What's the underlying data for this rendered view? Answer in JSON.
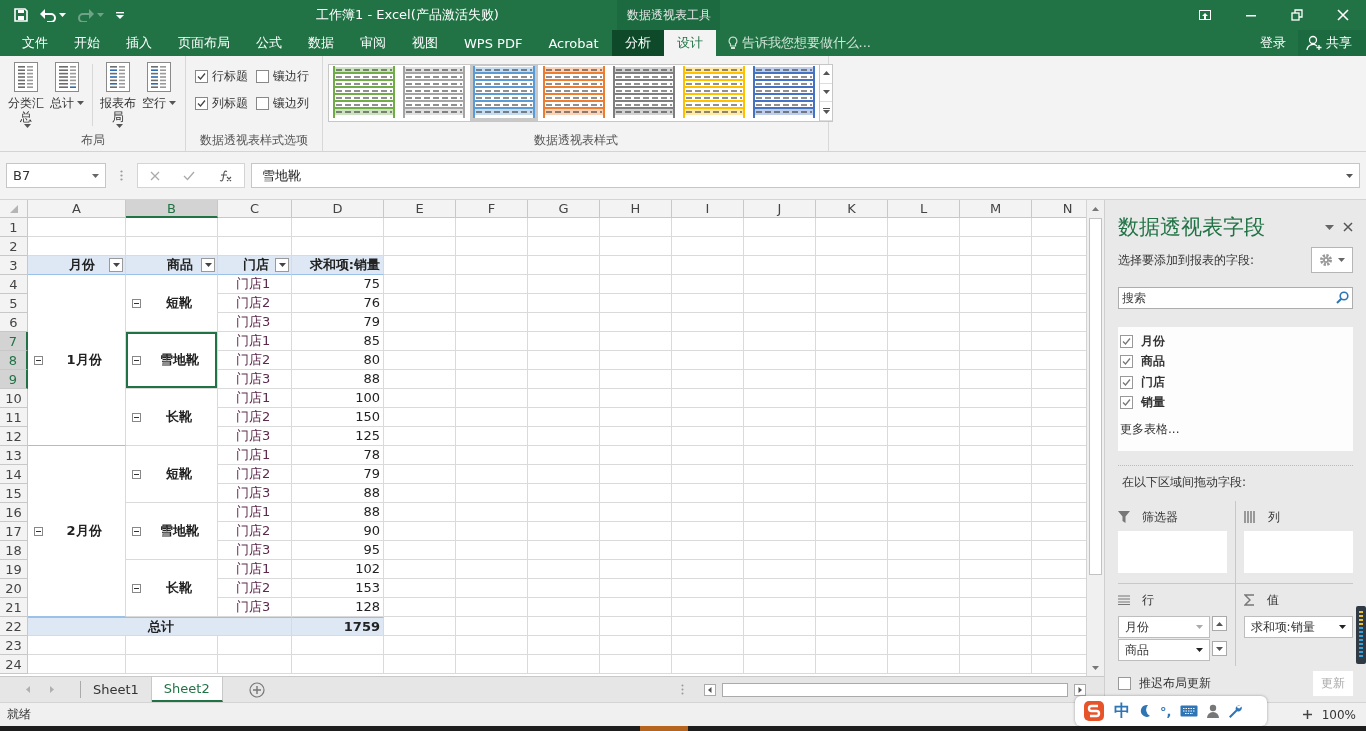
{
  "window": {
    "title": "工作簿1 - Excel(产品激活失败)",
    "context_group": "数据透视表工具",
    "sign_in": "登录",
    "share": "共享"
  },
  "quick_access": [
    {
      "kind": "save",
      "disabled": false
    },
    {
      "kind": "undo",
      "disabled": false
    },
    {
      "kind": "redo",
      "disabled": true
    },
    {
      "kind": "customize",
      "disabled": false
    }
  ],
  "tabs": [
    {
      "label": "文件",
      "selected": false,
      "contextual": false
    },
    {
      "label": "开始",
      "selected": false,
      "contextual": false
    },
    {
      "label": "插入",
      "selected": false,
      "contextual": false
    },
    {
      "label": "页面布局",
      "selected": false,
      "contextual": false
    },
    {
      "label": "公式",
      "selected": false,
      "contextual": false
    },
    {
      "label": "数据",
      "selected": false,
      "contextual": false
    },
    {
      "label": "审阅",
      "selected": false,
      "contextual": false
    },
    {
      "label": "视图",
      "selected": false,
      "contextual": false
    },
    {
      "label": "WPS PDF",
      "selected": false,
      "contextual": false
    },
    {
      "label": "Acrobat",
      "selected": false,
      "contextual": false
    },
    {
      "label": "分析",
      "selected": false,
      "contextual": true
    },
    {
      "label": "设计",
      "selected": true,
      "contextual": true
    }
  ],
  "tell_me": {
    "placeholder": "告诉我您想要做什么..."
  },
  "ribbon": {
    "groups": [
      {
        "kind": "buttons",
        "label": "布局",
        "buttons": [
          "分类汇总",
          "总计",
          "报表布局",
          "空行"
        ]
      },
      {
        "kind": "options",
        "label": "数据透视表样式选项",
        "options": [
          {
            "label": "行标题",
            "checked": true
          },
          {
            "label": "镶边行",
            "checked": false
          },
          {
            "label": "列标题",
            "checked": true
          },
          {
            "label": "镶边列",
            "checked": false
          }
        ]
      },
      {
        "kind": "gallery",
        "label": "数据透视表样式",
        "styles": [
          {
            "color": "#70ad47",
            "selected": false
          },
          {
            "color": "#a5a5a5",
            "selected": false
          },
          {
            "color": "#5b9bd5",
            "selected": true
          },
          {
            "color": "#ed7d31",
            "selected": false
          },
          {
            "color": "#7f7f7f",
            "selected": false
          },
          {
            "color": "#ffc000",
            "selected": false
          },
          {
            "color": "#4472c4",
            "selected": false
          }
        ]
      }
    ]
  },
  "formula_bar": {
    "name_box": "B7",
    "formula": "雪地靴"
  },
  "sheet": {
    "columns": [
      {
        "label": "A",
        "selected": false
      },
      {
        "label": "B",
        "selected": true
      },
      {
        "label": "C",
        "selected": false
      },
      {
        "label": "D",
        "selected": false
      },
      {
        "label": "E",
        "selected": false
      },
      {
        "label": "F",
        "selected": false
      },
      {
        "label": "G",
        "selected": false
      },
      {
        "label": "H",
        "selected": false
      },
      {
        "label": "I",
        "selected": false
      },
      {
        "label": "J",
        "selected": false
      },
      {
        "label": "K",
        "selected": false
      },
      {
        "label": "L",
        "selected": false
      },
      {
        "label": "M",
        "selected": false
      },
      {
        "label": "N",
        "selected": false
      }
    ],
    "rows": [
      {
        "label": "1",
        "selected": false
      },
      {
        "label": "2",
        "selected": false
      },
      {
        "label": "3",
        "selected": false
      },
      {
        "label": "4",
        "selected": false
      },
      {
        "label": "5",
        "selected": false
      },
      {
        "label": "6",
        "selected": false
      },
      {
        "label": "7",
        "selected": true
      },
      {
        "label": "8",
        "selected": true
      },
      {
        "label": "9",
        "selected": true
      },
      {
        "label": "10",
        "selected": false
      },
      {
        "label": "11",
        "selected": false
      },
      {
        "label": "12",
        "selected": false
      },
      {
        "label": "13",
        "selected": false
      },
      {
        "label": "14",
        "selected": false
      },
      {
        "label": "15",
        "selected": false
      },
      {
        "label": "16",
        "selected": false
      },
      {
        "label": "17",
        "selected": false
      },
      {
        "label": "18",
        "selected": false
      },
      {
        "label": "19",
        "selected": false
      },
      {
        "label": "20",
        "selected": false
      },
      {
        "label": "21",
        "selected": false
      },
      {
        "label": "22",
        "selected": false
      },
      {
        "label": "23",
        "selected": false
      },
      {
        "label": "24",
        "selected": false
      }
    ],
    "pivot": {
      "headers": [
        {
          "label": "月份",
          "filter": true
        },
        {
          "label": "商品",
          "filter": true
        },
        {
          "label": "门店",
          "filter": true
        },
        {
          "label": "求和项:销量",
          "filter": false
        }
      ],
      "months": [
        {
          "label": "1月份",
          "expanded": true,
          "products": [
            {
              "label": "短靴",
              "expanded": true,
              "selected": false,
              "stores": [
                {
                  "store": "门店1",
                  "value": "75"
                },
                {
                  "store": "门店2",
                  "value": "76"
                },
                {
                  "store": "门店3",
                  "value": "79"
                }
              ]
            },
            {
              "label": "雪地靴",
              "expanded": true,
              "selected": true,
              "stores": [
                {
                  "store": "门店1",
                  "value": "85"
                },
                {
                  "store": "门店2",
                  "value": "80"
                },
                {
                  "store": "门店3",
                  "value": "88"
                }
              ]
            },
            {
              "label": "长靴",
              "expanded": true,
              "selected": false,
              "stores": [
                {
                  "store": "门店1",
                  "value": "100"
                },
                {
                  "store": "门店2",
                  "value": "150"
                },
                {
                  "store": "门店3",
                  "value": "125"
                }
              ]
            }
          ]
        },
        {
          "label": "2月份",
          "expanded": true,
          "products": [
            {
              "label": "短靴",
              "expanded": true,
              "selected": false,
              "stores": [
                {
                  "store": "门店1",
                  "value": "78"
                },
                {
                  "store": "门店2",
                  "value": "79"
                },
                {
                  "store": "门店3",
                  "value": "88"
                }
              ]
            },
            {
              "label": "雪地靴",
              "expanded": true,
              "selected": false,
              "stores": [
                {
                  "store": "门店1",
                  "value": "88"
                },
                {
                  "store": "门店2",
                  "value": "90"
                },
                {
                  "store": "门店3",
                  "value": "95"
                }
              ]
            },
            {
              "label": "长靴",
              "expanded": true,
              "selected": false,
              "stores": [
                {
                  "store": "门店1",
                  "value": "102"
                },
                {
                  "store": "门店2",
                  "value": "153"
                },
                {
                  "store": "门店3",
                  "value": "128"
                }
              ]
            }
          ]
        }
      ],
      "total_label": "总计",
      "total": "1759"
    }
  },
  "sheet_tabs": [
    {
      "label": "Sheet1",
      "selected": false
    },
    {
      "label": "Sheet2",
      "selected": true
    }
  ],
  "field_panel": {
    "title": "数据透视表字段",
    "prompt": "选择要添加到报表的字段:",
    "search_placeholder": "搜索",
    "fields": [
      {
        "label": "月份",
        "checked": true
      },
      {
        "label": "商品",
        "checked": true
      },
      {
        "label": "门店",
        "checked": true
      },
      {
        "label": "销量",
        "checked": true
      }
    ],
    "more_tables": "更多表格...",
    "drag_prompt": "在以下区域间拖动字段:",
    "areas": [
      {
        "kind": "filters",
        "label": "筛选器"
      },
      {
        "kind": "columns",
        "label": "列"
      },
      {
        "kind": "rows",
        "label": "行",
        "items": [
          "月份",
          "商品"
        ]
      },
      {
        "kind": "values",
        "label": "值",
        "items": [
          "求和项:销量"
        ]
      }
    ],
    "defer": {
      "label": "推迟布局更新",
      "checked": false
    },
    "update": {
      "label": "更新",
      "disabled": true
    }
  },
  "status_bar": {
    "text": "就绪",
    "zoom": "100%"
  },
  "ime": {
    "mode": "中",
    "punctuation": "°,"
  }
}
